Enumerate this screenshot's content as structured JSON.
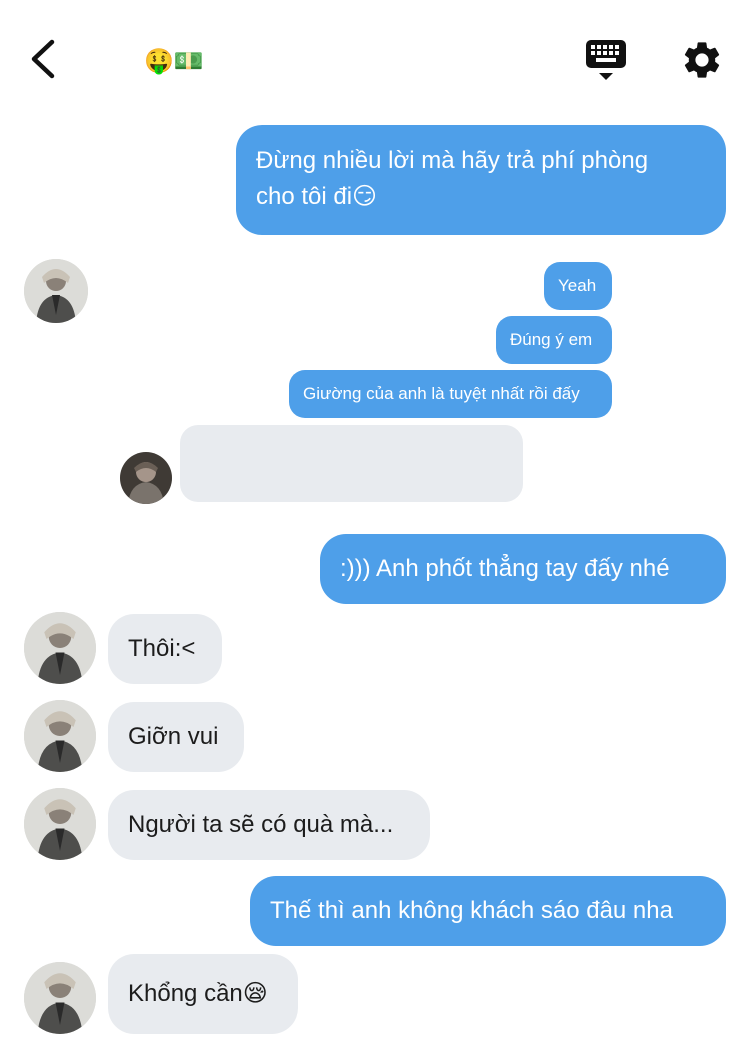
{
  "header": {
    "title": "🤑💵",
    "back_icon": "chevron-left-icon",
    "keyboard_icon": "keyboard-icon",
    "settings_icon": "gear-icon"
  },
  "colors": {
    "outgoing_bubble": "#4e9fe9",
    "incoming_bubble": "#e8ebef"
  },
  "messages": [
    {
      "direction": "outgoing",
      "text": "Đừng nhiều lời mà hãy trả phí phòng"
    },
    {
      "direction": "outgoing",
      "text": "cho tôi đi😏"
    },
    {
      "direction": "outgoing-quoted",
      "text": "Yeah"
    },
    {
      "direction": "outgoing-quoted",
      "text": "Đúng ý em"
    },
    {
      "direction": "outgoing-quoted",
      "text": "Giường của anh là tuyệt nhất rồi đấy"
    },
    {
      "direction": "incoming-quoted",
      "text": ""
    },
    {
      "direction": "outgoing",
      "text": ":))) Anh phốt thẳng tay đấy nhé"
    },
    {
      "direction": "incoming",
      "text": "Thôi:<"
    },
    {
      "direction": "incoming",
      "text": "Giỡn vui"
    },
    {
      "direction": "incoming",
      "text": "Người ta sẽ có quà mà..."
    },
    {
      "direction": "outgoing",
      "text": "Thế thì anh không khách sáo đâu nha"
    },
    {
      "direction": "incoming",
      "text": "Khổng cần😪"
    }
  ]
}
